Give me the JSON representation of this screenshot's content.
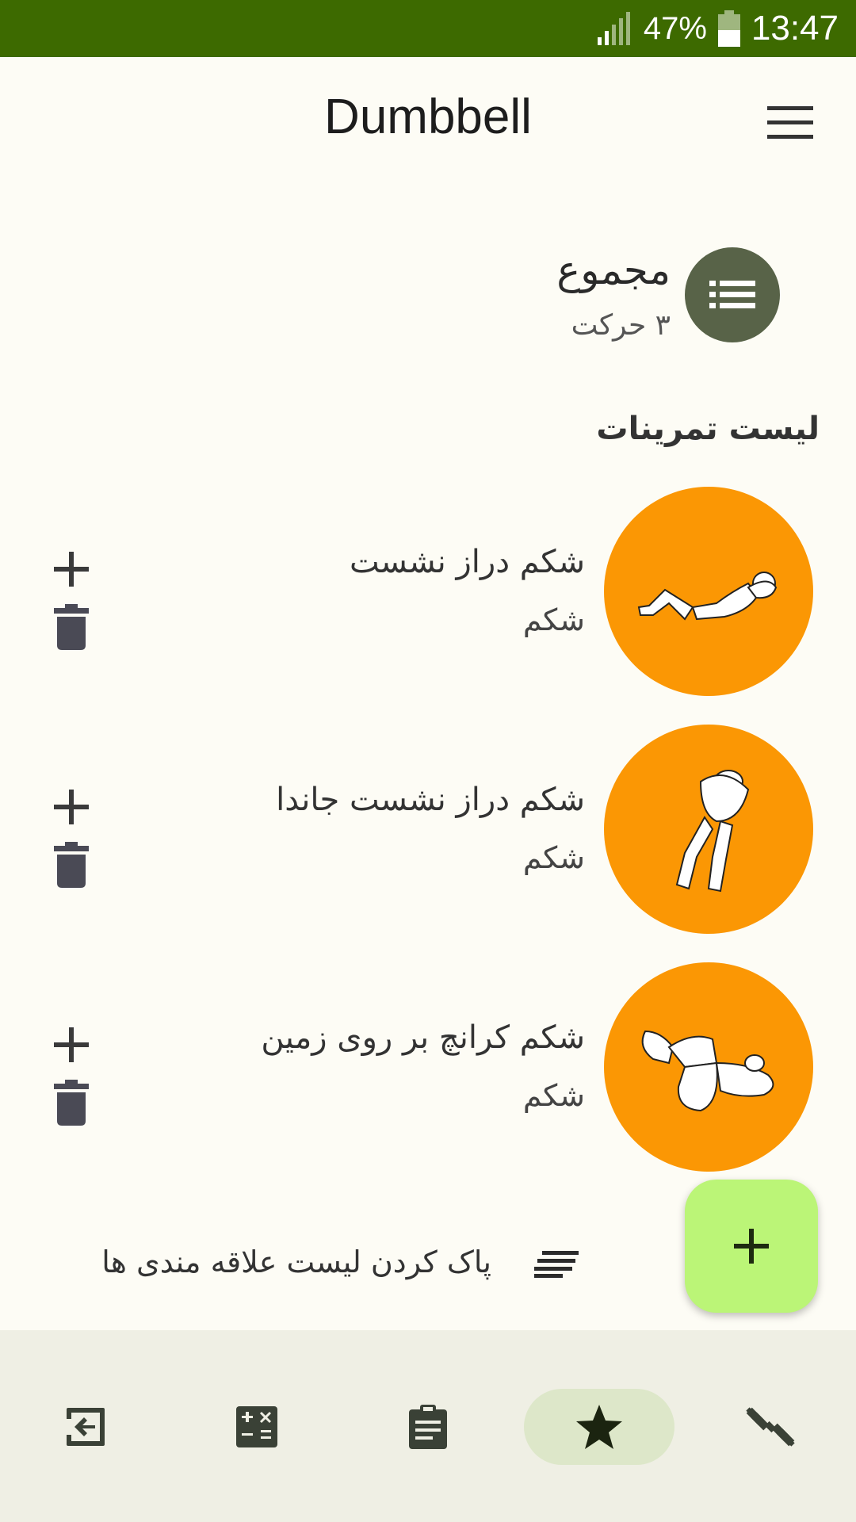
{
  "status_bar": {
    "battery_percent": "47%",
    "time": "13:47"
  },
  "app_bar": {
    "title": "Dumbbell"
  },
  "summary": {
    "title": "مجموع",
    "count": "۳ حرکت"
  },
  "section_title": "لیست تمرینات",
  "exercises": [
    {
      "name": "شکم دراز نشست",
      "category": "شکم"
    },
    {
      "name": "شکم دراز نشست جاندا",
      "category": "شکم"
    },
    {
      "name": "شکم کرانچ بر روی زمین",
      "category": "شکم"
    }
  ],
  "clear_favorites_label": "پاک کردن لیست علاقه مندی ها",
  "bottom_nav": {
    "items": [
      {
        "icon": "exit-icon"
      },
      {
        "icon": "calculator-icon"
      },
      {
        "icon": "clipboard-icon"
      },
      {
        "icon": "star-icon",
        "active": true
      },
      {
        "icon": "dumbbell-icon"
      }
    ]
  },
  "colors": {
    "status_bar": "#3d6a00",
    "background": "#fdfcf5",
    "exercise_circle": "#fb9704",
    "summary_circle": "#586348",
    "fab": "#bbf577",
    "nav_background": "#efefe4",
    "nav_active": "#dde7c9"
  }
}
